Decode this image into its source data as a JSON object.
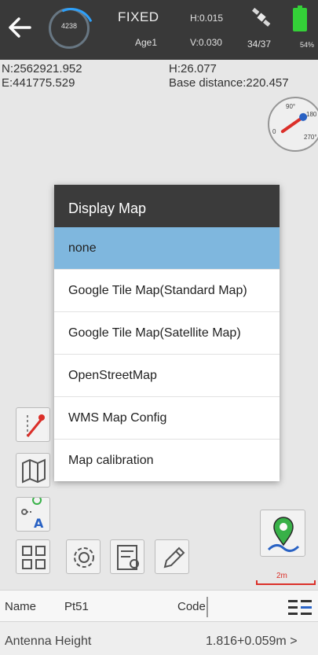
{
  "status": {
    "age_ring_value": "4238",
    "solution": "FIXED",
    "age": "Age1",
    "h_accuracy": "H:0.015",
    "v_accuracy": "V:0.030",
    "satellites": "34/37",
    "battery": "54%"
  },
  "coordinates": {
    "north": "N:2562921.952",
    "east": "E:441775.529",
    "height": "H:26.077",
    "base_distance": "Base distance:220.457"
  },
  "compass": {
    "n": "90°",
    "e": "180",
    "s": "270°",
    "w": "0"
  },
  "dialog": {
    "title": "Display Map",
    "options": [
      {
        "label": "none",
        "selected": true
      },
      {
        "label": "Google Tile Map(Standard Map)",
        "selected": false
      },
      {
        "label": "Google Tile Map(Satellite Map)",
        "selected": false
      },
      {
        "label": "OpenStreetMap",
        "selected": false
      },
      {
        "label": "WMS Map Config",
        "selected": false
      },
      {
        "label": "Map calibration",
        "selected": false
      }
    ]
  },
  "scale": {
    "label": "2m"
  },
  "point": {
    "name_label": "Name",
    "name_value": "Pt51",
    "code_label": "Code",
    "code_value": ""
  },
  "antenna": {
    "label": "Antenna Height",
    "value": "1.816+0.059m >"
  },
  "colors": {
    "accent": "#7fb7de",
    "header": "#3b3b3b",
    "status_green": "#36d63a",
    "marker_green": "#3ab54a"
  }
}
